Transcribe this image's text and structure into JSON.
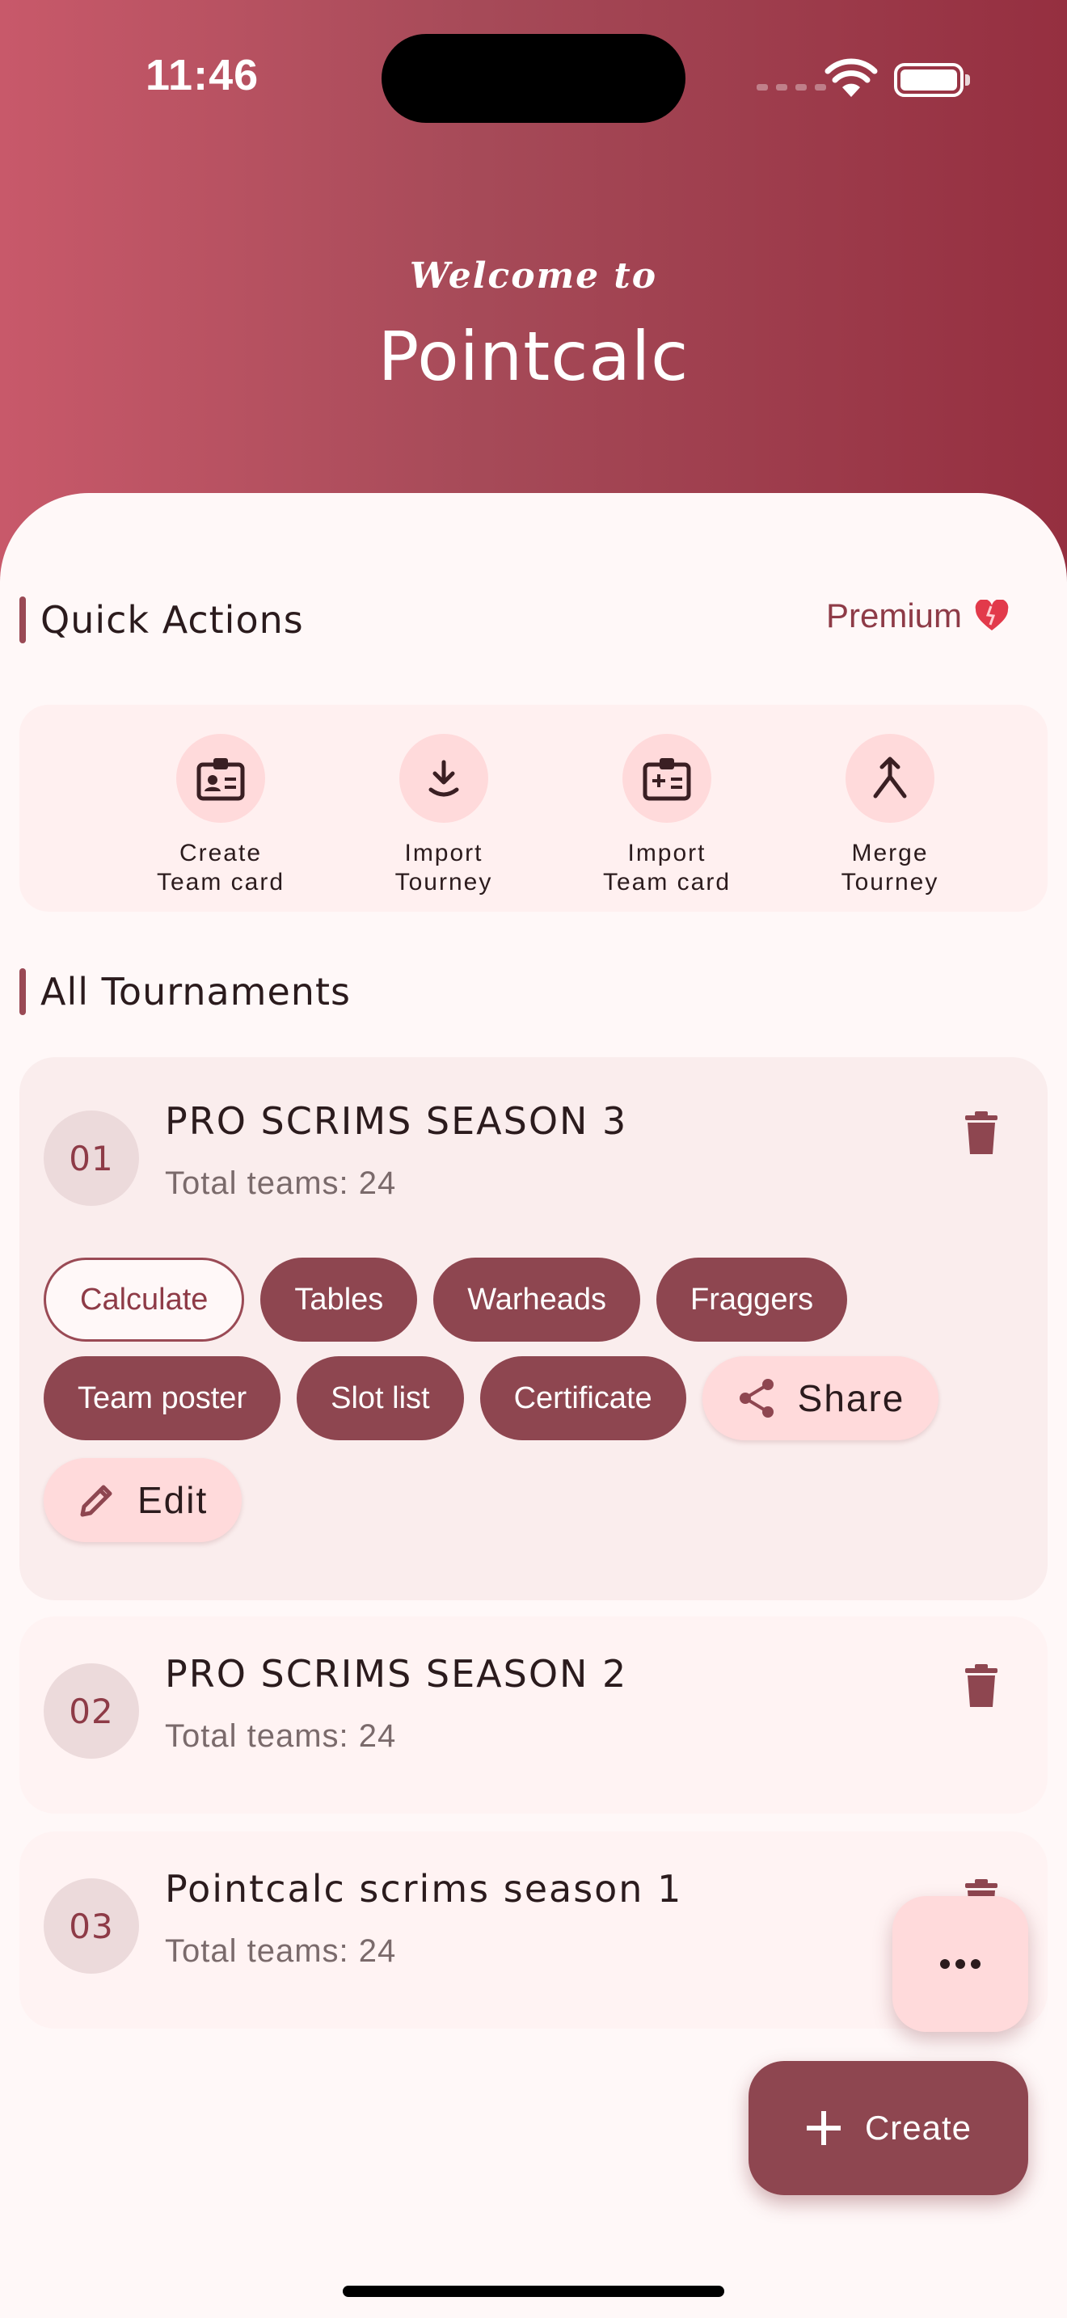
{
  "status_bar": {
    "time": "11:46"
  },
  "header": {
    "welcome": "Welcome to",
    "app_name": "Pointcalc"
  },
  "quick_actions": {
    "title": "Quick Actions",
    "premium_label": "Premium",
    "items": [
      {
        "label": "Create\nTeam card",
        "icon": "id-card-icon"
      },
      {
        "label": "Import\nTourney",
        "icon": "download-icon"
      },
      {
        "label": "Import\nTeam card",
        "icon": "add-card-icon"
      },
      {
        "label": "Merge\nTourney",
        "icon": "merge-icon"
      }
    ]
  },
  "tournaments": {
    "title": "All Tournaments",
    "items": [
      {
        "number": "01",
        "name": "PRO SCRIMS SEASON 3",
        "teams": "Total teams: 24",
        "expanded": true
      },
      {
        "number": "02",
        "name": "PRO SCRIMS SEASON 2",
        "teams": "Total teams: 24"
      },
      {
        "number": "03",
        "name": "Pointcalc scrims season 1",
        "teams": "Total teams: 24"
      }
    ],
    "actions": {
      "calculate": "Calculate",
      "tables": "Tables",
      "warheads": "Warheads",
      "fraggers": "Fraggers",
      "team_poster": "Team poster",
      "slot_list": "Slot list",
      "certificate": "Certificate",
      "share": "Share",
      "edit": "Edit"
    }
  },
  "fab": {
    "create_label": "Create"
  },
  "colors": {
    "primary": "#8E4650",
    "header_gradient_start": "#C8596A",
    "header_gradient_end": "#952F40",
    "tonal": "#FFDADB",
    "background": "#FFF8F8"
  }
}
